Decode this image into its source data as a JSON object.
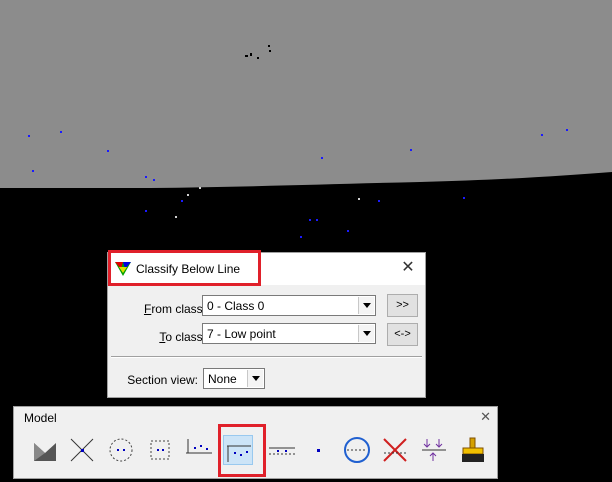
{
  "dialog": {
    "title": "Classify Below Line",
    "close_glyph": "✕",
    "from_label_key": "F",
    "from_label_rest": "rom class:",
    "from_value": "0 - Class 0",
    "to_label_key": "T",
    "to_label_rest": "o class:",
    "to_value": "7 - Low point",
    "button_forward": ">>",
    "button_swap": "<->",
    "section_label": "Section view:",
    "section_value": "None"
  },
  "toolbar": {
    "title": "Model",
    "close_glyph": "✕",
    "tools": [
      {
        "icon": "model-icon"
      },
      {
        "icon": "line-cross-icon"
      },
      {
        "icon": "circle-points-icon"
      },
      {
        "icon": "rectangle-points-icon"
      },
      {
        "icon": "above-line-icon"
      },
      {
        "icon": "below-line-icon",
        "selected": true
      },
      {
        "icon": "line-points-icon"
      },
      {
        "icon": "single-point-icon"
      },
      {
        "icon": "circle-line-icon"
      },
      {
        "icon": "red-cross-icon"
      },
      {
        "icon": "arrows-icon"
      },
      {
        "icon": "brush-icon"
      }
    ]
  },
  "colors": {
    "sky": "#8c8c8c",
    "ground": "#000000",
    "highlight": "#e0202a",
    "selected_tool_bg": "#cce4f7",
    "points": "#1a1aff"
  }
}
